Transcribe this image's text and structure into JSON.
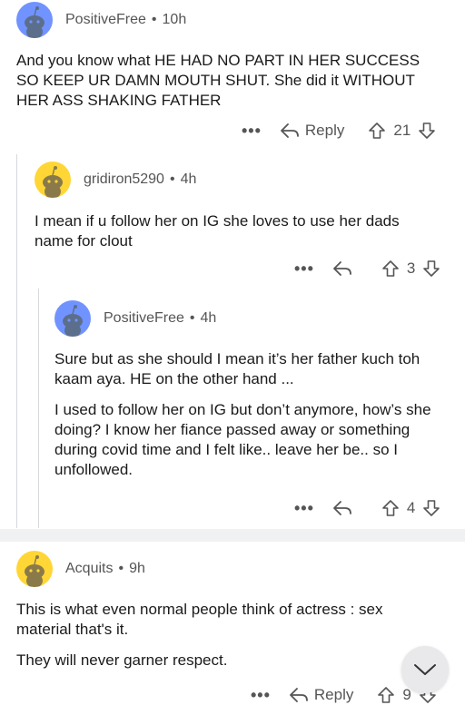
{
  "comments": [
    {
      "author": "PositiveFree",
      "time": "10h",
      "avatar_color": "#7193ff",
      "paragraphs": [
        "And you know what HE HAD NO PART IN HER SUCCESS SO KEEP UR DAMN MOUTH SHUT. She did it WITHOUT HER ASS SHAKING FATHER"
      ],
      "more_label": "•••",
      "reply_label": "Reply",
      "votes": "21"
    },
    {
      "author": "gridiron5290",
      "time": "4h",
      "avatar_color": "#ffd635",
      "paragraphs": [
        "I mean if u follow her on IG she loves to use her dads name for clout"
      ],
      "more_label": "•••",
      "votes": "3"
    },
    {
      "author": "PositiveFree",
      "time": "4h",
      "avatar_color": "#7193ff",
      "paragraphs": [
        "Sure but as she should I mean it’s her father kuch toh kaam aya. HE on the other hand ...",
        "I used to follow her on IG but don’t anymore, how’s she doing? I know her fiance passed away or something during covid time and I felt like.. leave her be.. so I unfollowed."
      ],
      "more_label": "•••",
      "votes": "4"
    },
    {
      "author": "Acquits",
      "time": "9h",
      "avatar_color": "#ffd635",
      "paragraphs": [
        "This is what even normal people think of actress : sex material that's it.",
        "They will never garner respect."
      ],
      "more_label": "•••",
      "reply_label": "Reply",
      "votes": "9"
    }
  ],
  "dot_separator": "•",
  "icons": {
    "reply": "reply-arrow-icon",
    "upvote": "upvote-arrow-icon",
    "downvote": "downvote-arrow-icon",
    "scroll": "chevron-down-icon",
    "avatar": "snoo-avatar-icon"
  }
}
